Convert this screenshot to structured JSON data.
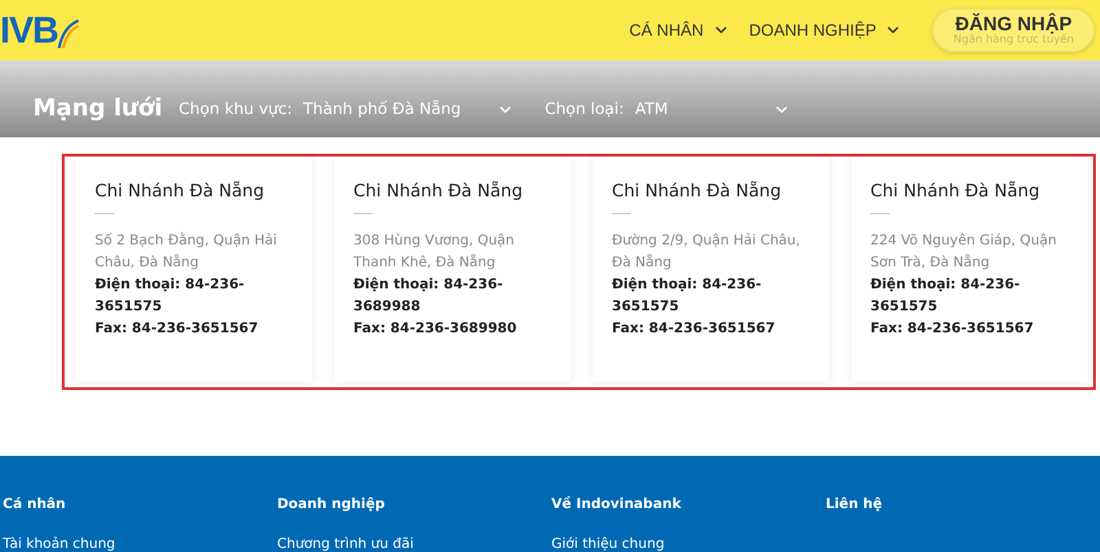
{
  "header": {
    "logo": "IVB",
    "nav": [
      {
        "label": "CÁ NHÂN"
      },
      {
        "label": "DOANH NGHIỆP"
      }
    ],
    "login": {
      "label": "ĐĂNG NHẬP",
      "sub": "Ngân hàng trực tuyến"
    }
  },
  "network_bar": {
    "title": "Mạng lưới",
    "filters": [
      {
        "label": "Chọn khu vực:",
        "value": "Thành phố Đà Nẵng"
      },
      {
        "label": "Chọn loại:",
        "value": "ATM"
      }
    ]
  },
  "branches": [
    {
      "name": "Chi Nhánh Đà Nẵng",
      "address": "Số 2 Bạch Đằng, Quận Hải Châu, Đà Nẵng",
      "phone": "Điện thoại: 84-236-3651575",
      "fax": "Fax: 84-236-3651567"
    },
    {
      "name": "Chi Nhánh Đà Nẵng",
      "address": "308 Hùng Vương, Quận Thanh Khê, Đà Nẵng",
      "phone": "Điện thoại: 84-236-3689988",
      "fax": "Fax: 84-236-3689980"
    },
    {
      "name": "Chi Nhánh Đà Nẵng",
      "address": "Đường 2/9, Quận Hải Châu, Đà Nẵng",
      "phone": "Điện thoại: 84-236-3651575",
      "fax": "Fax: 84-236-3651567"
    },
    {
      "name": "Chi Nhánh Đà Nẵng",
      "address": "224 Võ Nguyên Giáp, Quận Sơn Trà, Đà Nẵng",
      "phone": "Điện thoại: 84-236-3651575",
      "fax": "Fax: 84-236-3651567"
    }
  ],
  "footer": {
    "columns": [
      {
        "heading": "Cá nhân",
        "links": [
          "Tài khoản chung"
        ]
      },
      {
        "heading": "Doanh nghiệp",
        "links": [
          "Chương trình ưu đãi"
        ]
      },
      {
        "heading": "Về Indovinabank",
        "links": [
          "Giới thiệu chung"
        ]
      },
      {
        "heading": "Liên hệ"
      }
    ]
  }
}
